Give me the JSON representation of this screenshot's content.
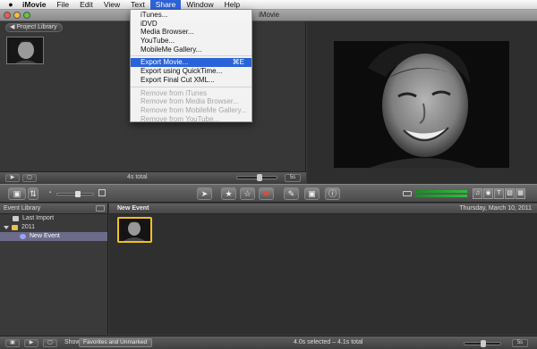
{
  "menubar": {
    "apple": "",
    "items": [
      "iMovie",
      "File",
      "Edit",
      "View",
      "Text",
      "Share",
      "Window",
      "Help"
    ],
    "active": "Share"
  },
  "window": {
    "title": "iMovie"
  },
  "project": {
    "library_button": "Project Library",
    "total": "4s total",
    "seconds": "5s"
  },
  "share_menu": {
    "group1": [
      "iTunes...",
      "iDVD",
      "Media Browser...",
      "YouTube...",
      "MobileMe Gallery..."
    ],
    "export_movie": {
      "label": "Export Movie...",
      "shortcut": "⌘E"
    },
    "group2": [
      "Export using QuickTime...",
      "Export Final Cut XML..."
    ],
    "disabled": [
      "Remove from iTunes",
      "Remove from Media Browser...",
      "Remove from MobileMe Gallery...",
      "Remove from YouTube..."
    ]
  },
  "event_library": {
    "title": "Event Library",
    "items": [
      {
        "label": "Last Import"
      },
      {
        "label": "2011"
      },
      {
        "label": "New Event",
        "selected": true
      }
    ]
  },
  "event_browser": {
    "title": "New Event",
    "date": "Thursday, March 10, 2011"
  },
  "statusbar": {
    "show_label": "Show:",
    "show_value": "Favorites and Unmarked",
    "selection_info": "4.0s selected – 4.1s total",
    "seconds": "5s"
  },
  "colors": {
    "menu_highlight": "#2a62d9",
    "clip_selection": "#f1c21e",
    "audio_level": "#2dbf3c"
  }
}
